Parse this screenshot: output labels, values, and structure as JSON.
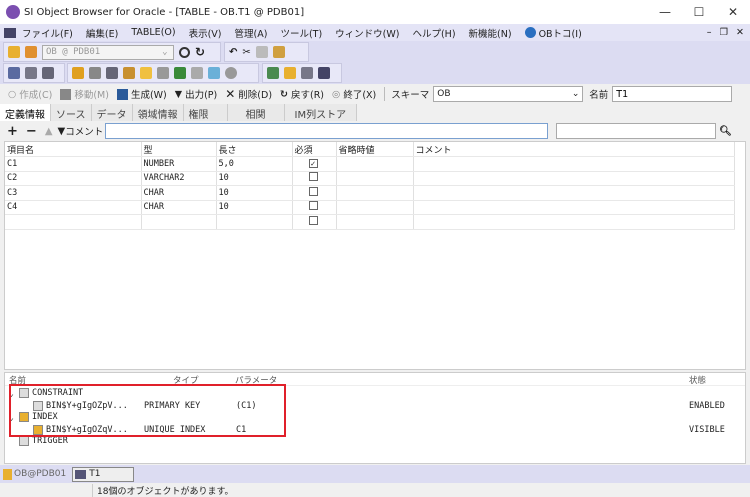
{
  "window": {
    "title": "SI Object Browser for Oracle - [TABLE - OB.T1 @ PDB01]",
    "min": "—",
    "max": "☐",
    "close": "✕"
  },
  "menu": [
    "ファイル(F)",
    "編集(E)",
    "TABLE(O)",
    "表示(V)",
    "管理(A)",
    "ツール(T)",
    "ウィンドウ(W)",
    "ヘルプ(H)",
    "新機能(N)",
    "OBトコ(I)"
  ],
  "mdi": {
    "min": "–",
    "restore": "❐",
    "close": "✕"
  },
  "connection": {
    "value": "OB @ PDB01"
  },
  "actions": [
    {
      "label": "作成(C)",
      "icon": "circle-icon",
      "enabled": false
    },
    {
      "label": "移動(M)",
      "icon": "move-icon",
      "enabled": false
    },
    {
      "label": "生成(W)",
      "icon": "generate-icon",
      "enabled": true
    },
    {
      "label": "出力(P)",
      "icon": "output-icon",
      "enabled": true
    },
    {
      "label": "削除(D)",
      "icon": "delete-icon",
      "enabled": true
    },
    {
      "label": "戻す(R)",
      "icon": "undo-icon",
      "enabled": true
    },
    {
      "label": "終了(X)",
      "icon": "exit-icon",
      "enabled": true
    }
  ],
  "schema": {
    "label": "スキーマ",
    "value": "OB"
  },
  "name": {
    "label": "名前",
    "value": "T1"
  },
  "tabs": [
    "定義情報",
    "ソース",
    "データ",
    "領域情報",
    "権限",
    "相関",
    "IM列ストア"
  ],
  "comment": {
    "label": "コメント",
    "value": "",
    "search": ""
  },
  "grid": {
    "headers": [
      "項目名",
      "型",
      "長さ",
      "必須",
      "省略時値",
      "コメント"
    ],
    "rows": [
      [
        "C1",
        "NUMBER",
        "5,0",
        true,
        "",
        ""
      ],
      [
        "C2",
        "VARCHAR2",
        "10",
        false,
        "",
        ""
      ],
      [
        "C3",
        "CHAR",
        "10",
        false,
        "",
        ""
      ],
      [
        "C4",
        "CHAR",
        "10",
        false,
        "",
        ""
      ],
      [
        "",
        "",
        "",
        false,
        "",
        ""
      ]
    ]
  },
  "lower": {
    "headers": [
      "名前",
      "タイプ",
      "パラメータ",
      "状態"
    ],
    "items": [
      {
        "name": "CONSTRAINT",
        "type": "",
        "param": "",
        "state": ""
      },
      {
        "name": "BIN$Y+gIgOZpV...",
        "type": "PRIMARY KEY",
        "param": "(C1)",
        "state": "ENABLED"
      },
      {
        "name": "INDEX",
        "type": "",
        "param": "",
        "state": ""
      },
      {
        "name": "BIN$Y+gIgOZqV...",
        "type": "UNIQUE INDEX",
        "param": "C1",
        "state": "VISIBLE"
      },
      {
        "name": "TRIGGER",
        "type": "",
        "param": "",
        "state": ""
      }
    ]
  },
  "bottom_tabs": [
    "OB@PDB01",
    "T1"
  ],
  "status": "18個のオブジェクトがあります。",
  "colors": {
    "highlight": "#e0202a",
    "toolbar": "#dcdcf2"
  }
}
